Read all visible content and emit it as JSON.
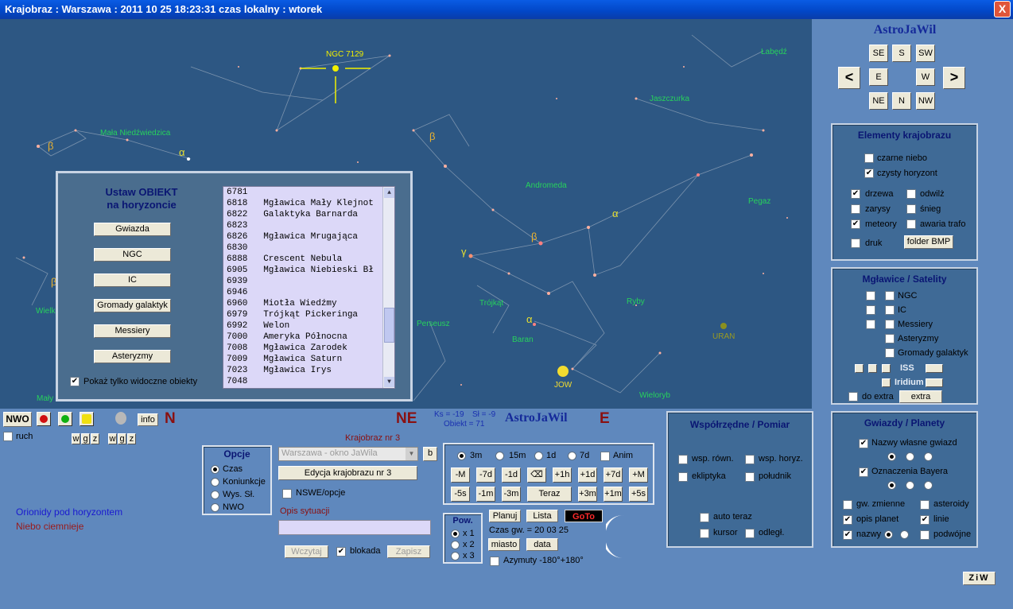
{
  "window": {
    "title": "Krajobraz  :  Warszawa  :  2011 10 25   18:23:31   czas lokalny  :  wtorek",
    "close": "X"
  },
  "sky": {
    "labels": [
      "NGC 7129",
      "Łabędź",
      "Jaszczurka",
      "Mała Niedźwiedzica",
      "Andromeda",
      "Pegaz",
      "Trójkąt",
      "Ryby",
      "Perseusz",
      "Baran",
      "URAN",
      "JOWISZ",
      "Wieloryb",
      "Wielk",
      "Mały"
    ],
    "greek": [
      "β",
      "α",
      "β",
      "α",
      "γ",
      "β",
      "α",
      "β"
    ],
    "jow": "JOW"
  },
  "dialog": {
    "title1": "Ustaw  OBIEKT",
    "title2": "na horyzoncie",
    "buttons": [
      "Gwiazda",
      "NGC",
      "IC",
      "Gromady galaktyk",
      "Messiery",
      "Asteryzmy"
    ],
    "checkbox_label": "Pokaż tylko widoczne obiekty",
    "list": [
      "6781",
      "6818   Mgławica Mały Klejnot",
      "6822   Galaktyka Barnarda",
      "6823",
      "6826   Mgławica Mrugająca",
      "6830",
      "6888   Crescent Nebula",
      "6905   Mgławica Niebieski Bł",
      "6939",
      "6946",
      "6960   Miotła Wiedźmy",
      "6979   Trójkąt Pickeringa",
      "6992   Welon",
      "7000   Ameryka Północna",
      "7008   Mgławica Zarodek",
      "7009   Mgławica Saturn",
      "7023   Mgławica Irys",
      "7048"
    ]
  },
  "right": {
    "brand": "AstroJaWil",
    "dirs": {
      "se": "SE",
      "s": "S",
      "sw": "SW",
      "e": "E",
      "w": "W",
      "ne": "NE",
      "n": "N",
      "nw": "NW",
      "left": "<",
      "right": ">"
    },
    "krajobraz": {
      "title": "Elementy krajobrazu",
      "items": [
        "czarne niebo",
        "czysty horyzont",
        "drzewa",
        "odwilż",
        "zarysy",
        "śnieg",
        "meteory",
        "awaria trafo",
        "druk"
      ],
      "folder": "folder BMP"
    },
    "mglawice": {
      "title": "Mgławice / Satelity",
      "items": [
        "NGC",
        "IC",
        "Messiery",
        "Asteryzmy",
        "Gromady galaktyk"
      ],
      "iss": "ISS",
      "iridium": "Iridium",
      "doextra": "do extra",
      "extra": "extra"
    },
    "gwiazdy": {
      "title": "Gwiazdy / Planety",
      "names": "Nazwy własne gwiazd",
      "bayer": "Oznaczenia Bayera",
      "items": [
        "gw. zmienne",
        "asteroidy",
        "opis planet",
        "linie",
        "nazwy",
        "podwójne"
      ]
    },
    "ziw": "ZiW"
  },
  "bottom": {
    "nwo": "NWO",
    "info": "info",
    "N": "N",
    "NE": "NE",
    "E": "E",
    "ruch": "ruch",
    "wgz": [
      "w",
      "g",
      "z",
      "w",
      "g",
      "z"
    ],
    "ks": "Ks = -19",
    "sl": "Sł = -9",
    "obiekt": "Obiekt = 71",
    "brand": "AstroJaWil",
    "orionidy": "Orionidy pod horyzontem",
    "niebo": "Niebo ciemnieje",
    "opcje": {
      "title": "Opcje",
      "items": [
        "Czas",
        "Koniunkcje",
        "Wys. Sł.",
        "NWO"
      ]
    },
    "krajobraz_nr": "Krajobraz nr 3",
    "combo": "Warszawa - okno JaWila",
    "b": "b",
    "edycja": "Edycja krajobrazu nr 3",
    "nswe": "NSWE/opcje",
    "opis": "Opis sytuacji",
    "wczytaj": "Wczytaj",
    "blokada": "blokada",
    "zapisz": "Zapisz",
    "time": {
      "radios": [
        "3m",
        "15m",
        "1d",
        "7d"
      ],
      "anim": "Anim",
      "row1": [
        "-M",
        "-7d",
        "-1d",
        "⌫",
        "+1h",
        "+1d",
        "+7d",
        "+M"
      ],
      "row2": [
        "-5s",
        "-1m",
        "-3m",
        "Teraz",
        "+3m",
        "+1m",
        "+5s"
      ]
    },
    "pow": {
      "title": "Pow.",
      "items": [
        "x 1",
        "x 2",
        "x 3"
      ]
    },
    "planuj": "Planuj",
    "lista": "Lista",
    "goto": "GoTo",
    "czasgw": "Czas gw. =   20 03 25",
    "miasto": "miasto",
    "data": "data",
    "azymuty": "Azymuty -180°+180°",
    "wsp": {
      "title": "Współrzędne / Pomiar",
      "items": [
        "wsp. równ.",
        "wsp. horyz.",
        "ekliptyka",
        "południk",
        "auto teraz",
        "kursor",
        "odległ."
      ]
    }
  },
  "colors": {
    "sky": "#2d5783",
    "panel": "#5f88bd",
    "constellation": "#27d25c",
    "brand": "#152a9a"
  }
}
